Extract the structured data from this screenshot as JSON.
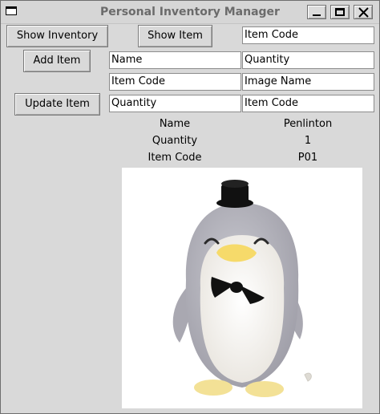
{
  "window": {
    "title": "Personal Inventory Manager"
  },
  "buttons": {
    "show_inventory": "Show Inventory",
    "show_item": "Show Item",
    "add_item": "Add Item",
    "update_item": "Update Item"
  },
  "fields": {
    "show_item_code": "Item Code",
    "add_name": "Name",
    "add_quantity": "Quantity",
    "add_item_code": "Item Code",
    "add_image_name": "Image Name",
    "update_quantity": "Quantity",
    "update_item_code": "Item Code"
  },
  "details": [
    {
      "label": "Name",
      "value": "Penlinton"
    },
    {
      "label": "Quantity",
      "value": "1"
    },
    {
      "label": "Item Code",
      "value": "P01"
    }
  ],
  "image": {
    "icon": "penguin-plush-with-top-hat-and-bow-tie"
  }
}
